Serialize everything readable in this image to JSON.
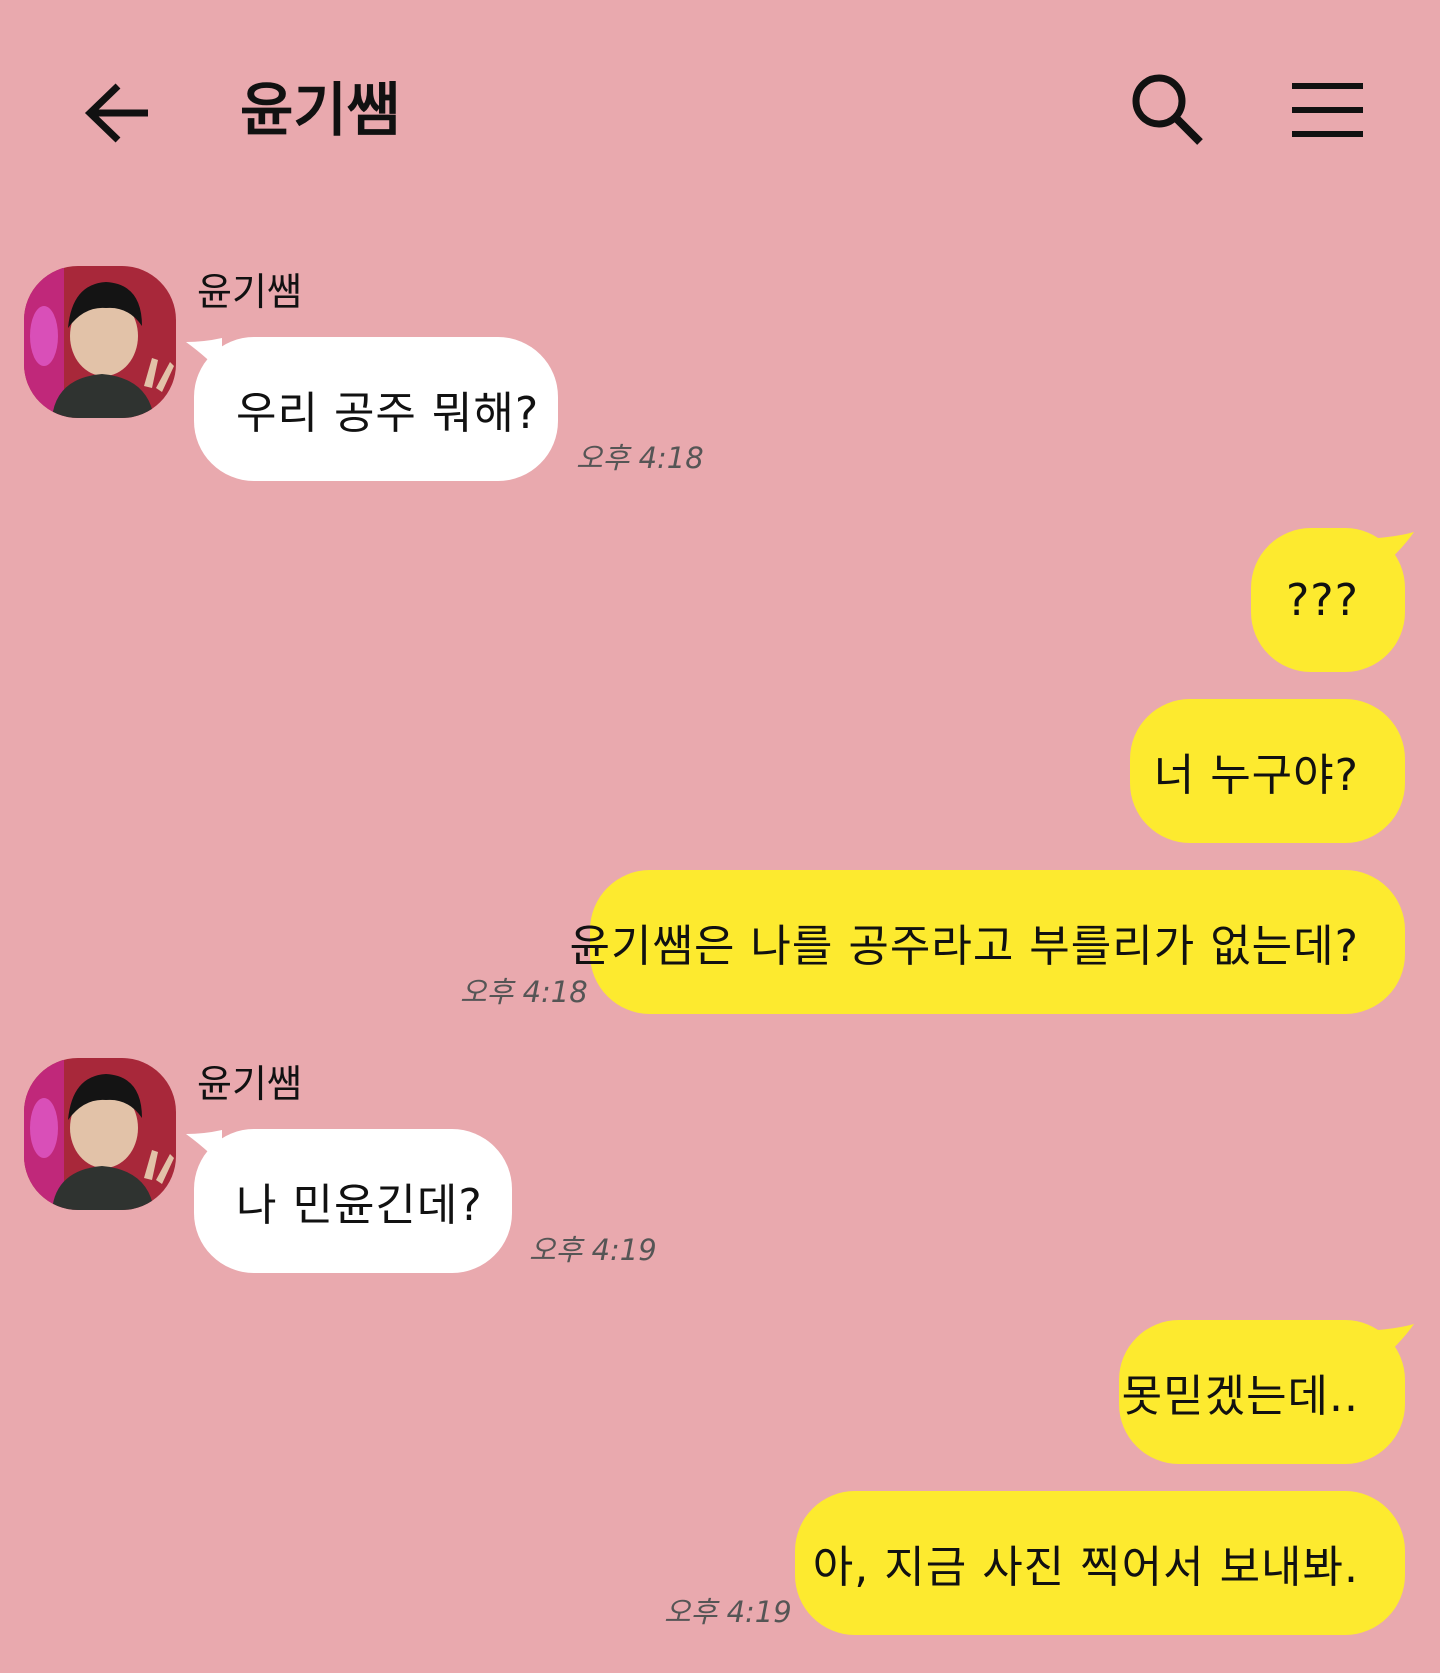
{
  "header": {
    "title": "윤기쌤",
    "back_icon": "back-arrow-icon",
    "search_icon": "search-icon",
    "menu_icon": "hamburger-menu-icon"
  },
  "colors": {
    "background": "#e9a9ae",
    "incoming_bubble": "#ffffff",
    "outgoing_bubble": "#fdea2f"
  },
  "messages": [
    {
      "direction": "in",
      "sender": "윤기쌤",
      "text": "우리 공주 뭐해?",
      "time": "오후 4:18"
    },
    {
      "direction": "out",
      "text": "???",
      "time": ""
    },
    {
      "direction": "out",
      "text": "너 누구야?",
      "time": ""
    },
    {
      "direction": "out",
      "text": "윤기쌤은 나를 공주라고 부를리가 없는데?",
      "time": "오후 4:18"
    },
    {
      "direction": "in",
      "sender": "윤기쌤",
      "text": "나 민윤긴데?",
      "time": "오후 4:19"
    },
    {
      "direction": "out",
      "text": "못믿겠는데..",
      "time": ""
    },
    {
      "direction": "out",
      "text": "아, 지금 사진 찍어서 보내봐.",
      "time": "오후 4:19"
    }
  ]
}
